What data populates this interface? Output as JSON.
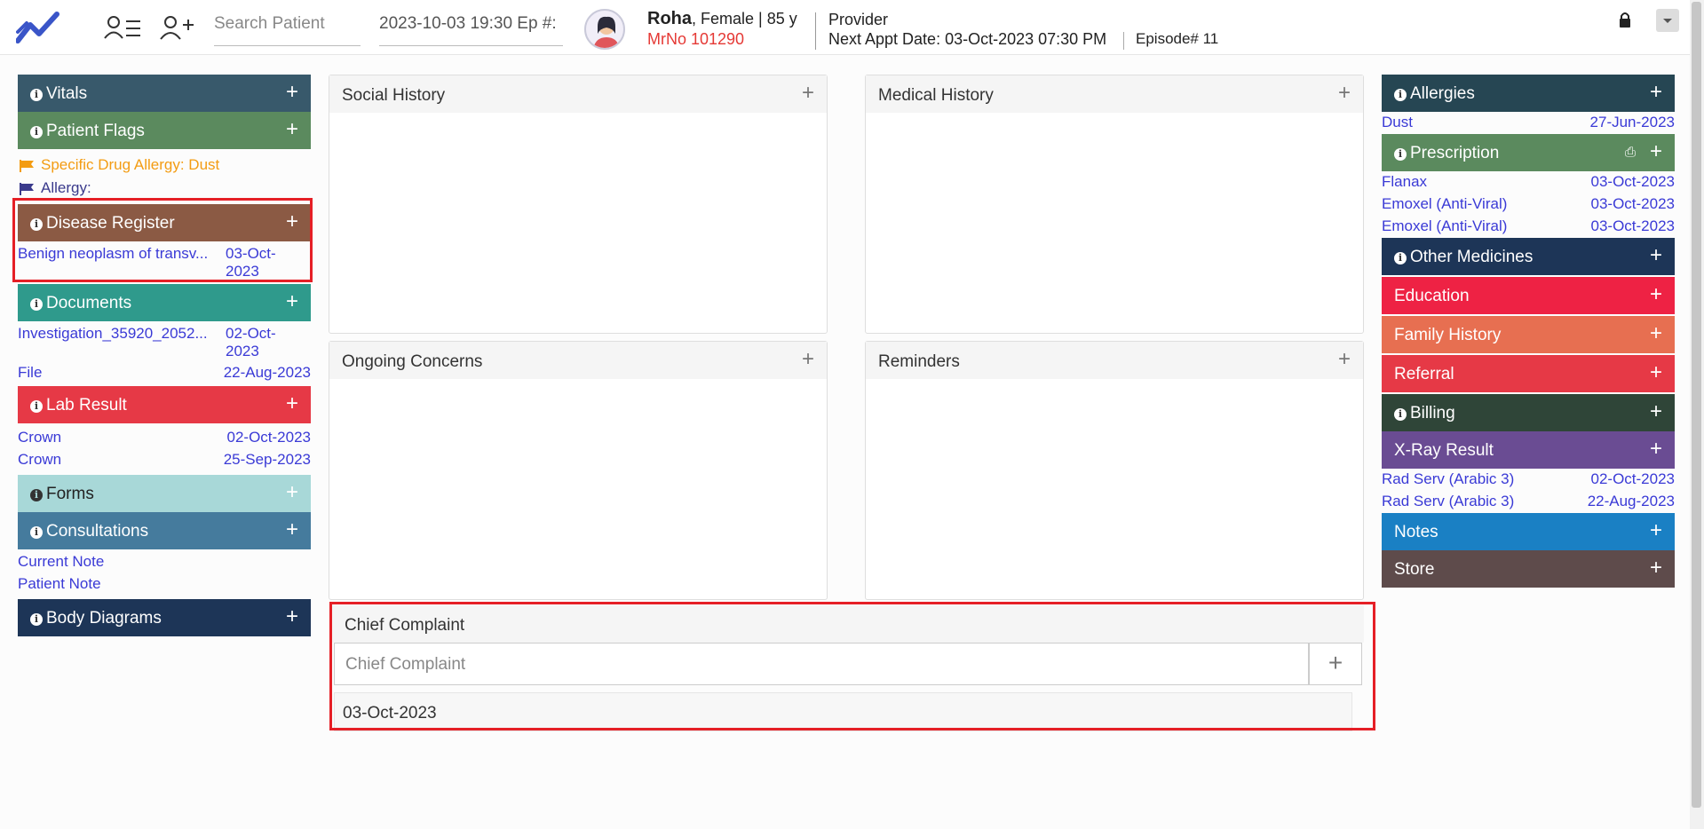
{
  "topbar": {
    "search_placeholder": "Search Patient",
    "episode_field": "2023-10-03 19:30 Ep #:",
    "patient_name": "Roha",
    "patient_info": ", Female | 85 y",
    "mrno": "MrNo 101290",
    "provider": "Provider",
    "next_appt_label": "Next Appt Date",
    "next_appt_value": ": 03-Oct-2023 07:30 PM",
    "episode": "Episode# 11"
  },
  "left": {
    "vitals": "Vitals",
    "patient_flags": "Patient Flags",
    "flags": [
      {
        "text": "Specific Drug Allergy: Dust",
        "color": "#f39c12"
      },
      {
        "text": "Allergy:",
        "color": "#3a3a8c"
      }
    ],
    "disease_register": "Disease Register",
    "disease_items": [
      {
        "name": "Benign neoplasm of transv...",
        "date_line1": "03-Oct-",
        "date_line2": "2023"
      }
    ],
    "documents": "Documents",
    "document_items": [
      {
        "name": "Investigation_35920_2052...",
        "date_line1": "02-Oct-",
        "date_line2": "2023"
      },
      {
        "name": "File",
        "date": "22-Aug-2023"
      }
    ],
    "lab_result": "Lab Result",
    "lab_items": [
      {
        "name": "Crown",
        "date": "02-Oct-2023"
      },
      {
        "name": "Crown",
        "date": "25-Sep-2023"
      }
    ],
    "forms": "Forms",
    "consultations": "Consultations",
    "consultation_items": [
      "Current Note",
      "Patient Note"
    ],
    "body_diagrams": "Body Diagrams"
  },
  "center": {
    "social_history": "Social History",
    "medical_history": "Medical History",
    "ongoing_concerns": "Ongoing Concerns",
    "reminders": "Reminders",
    "chief_complaint": "Chief Complaint",
    "chief_complaint_placeholder": "Chief Complaint",
    "chief_complaint_date": "03-Oct-2023"
  },
  "right": {
    "allergies": "Allergies",
    "allergy_items": [
      {
        "name": "Dust",
        "date": "27-Jun-2023"
      }
    ],
    "prescription": "Prescription",
    "prescription_items": [
      {
        "name": "Flanax",
        "date": "03-Oct-2023"
      },
      {
        "name": "Emoxel (Anti-Viral)",
        "date": "03-Oct-2023"
      },
      {
        "name": "Emoxel (Anti-Viral)",
        "date": "03-Oct-2023"
      }
    ],
    "other_medicines": "Other Medicines",
    "education": "Education",
    "family_history": "Family History",
    "referral": "Referral",
    "billing": "Billing",
    "xray_result": "X-Ray Result",
    "xray_items": [
      {
        "name": "Rad Serv (Arabic 3)",
        "date": "02-Oct-2023"
      },
      {
        "name": "Rad Serv (Arabic 3)",
        "date": "22-Aug-2023"
      }
    ],
    "notes": "Notes",
    "store": "Store"
  },
  "colors": {
    "vitals": "#38596b",
    "patient_flags": "#5b8a5e",
    "disease_register": "#8b5a44",
    "documents": "#2f9a8c",
    "lab_result": "#e63946",
    "forms": "#a8d8d8",
    "consultations": "#457b9d",
    "body_diagrams": "#1d3557",
    "allergies": "#264653",
    "prescription": "#5b8a5e",
    "other_medicines": "#1d3557",
    "education": "#ee2244",
    "family_history": "#e76f51",
    "referral": "#e63946",
    "billing": "#2f4538",
    "xray_result": "#6a4c93",
    "notes": "#1a80c4",
    "store": "#5e4b4b",
    "highlight": "#e51f26"
  }
}
